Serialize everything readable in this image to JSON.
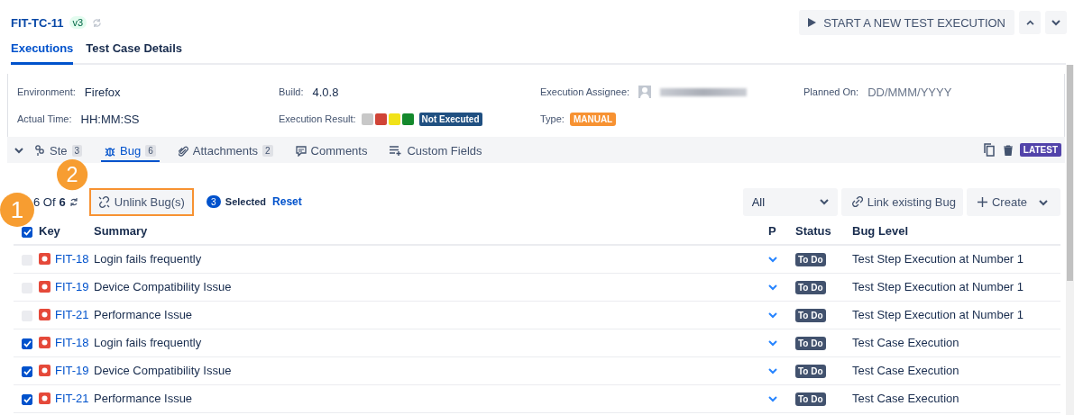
{
  "header": {
    "key": "FIT-TC-11",
    "version": "v3",
    "start_button": "START A NEW TEST EXECUTION"
  },
  "tabs": [
    {
      "label": "Executions",
      "selected": true
    },
    {
      "label": "Test Case Details",
      "selected": false
    }
  ],
  "details": {
    "environment_label": "Environment:",
    "environment": "Firefox",
    "build_label": "Build:",
    "build": "4.0.8",
    "assignee_label": "Execution Assignee:",
    "planned_label": "Planned On:",
    "planned": "DD/MMM/YYYY",
    "actual_time_label": "Actual Time:",
    "actual_time": "HH:MM:SS",
    "result_label": "Execution Result:",
    "result_options": [
      {
        "color": "#c8c8c8"
      },
      {
        "color": "#d04437"
      },
      {
        "color": "#f1e219"
      },
      {
        "color": "#14892c"
      }
    ],
    "result": "Not Executed",
    "type_label": "Type:",
    "type": "MANUAL"
  },
  "sub_tabs": [
    {
      "label": "Ste",
      "count": "3",
      "selected": false
    },
    {
      "label": "Bug",
      "count": "6",
      "selected": true
    },
    {
      "label": "Attachments",
      "count": "2",
      "selected": false
    },
    {
      "label": "Comments",
      "selected": false
    },
    {
      "label": "Custom Fields",
      "selected": false
    }
  ],
  "latest_badge": "LATEST",
  "toolbar": {
    "shown": "6",
    "of": "Of",
    "total": "6",
    "unlink_button": "Unlink Bug(s)",
    "selected_count": "3",
    "selected_label": "Selected",
    "reset": "Reset",
    "filter": "All",
    "link_button": "Link existing Bug",
    "create_button": "Create"
  },
  "callouts": [
    "1",
    "2"
  ],
  "table": {
    "columns": [
      "Key",
      "Summary",
      "P",
      "Status",
      "Bug Level"
    ],
    "all_checked": true,
    "rows": [
      {
        "checked": false,
        "disabled": true,
        "key": "FIT-18",
        "summary": "Login fails frequently",
        "status": "To Do",
        "level": "Test Step Execution at Number 1"
      },
      {
        "checked": false,
        "disabled": true,
        "key": "FIT-19",
        "summary": "Device Compatibility Issue",
        "status": "To Do",
        "level": "Test Step Execution at Number 1"
      },
      {
        "checked": false,
        "disabled": true,
        "key": "FIT-21",
        "summary": "Performance Issue",
        "status": "To Do",
        "level": "Test Step Execution at Number 1"
      },
      {
        "checked": true,
        "disabled": false,
        "key": "FIT-18",
        "summary": "Login fails frequently",
        "status": "To Do",
        "level": "Test Case Execution"
      },
      {
        "checked": true,
        "disabled": false,
        "key": "FIT-19",
        "summary": "Device Compatibility Issue",
        "status": "To Do",
        "level": "Test Case Execution"
      },
      {
        "checked": true,
        "disabled": false,
        "key": "FIT-21",
        "summary": "Performance Issue",
        "status": "To Do",
        "level": "Test Case Execution"
      }
    ]
  }
}
